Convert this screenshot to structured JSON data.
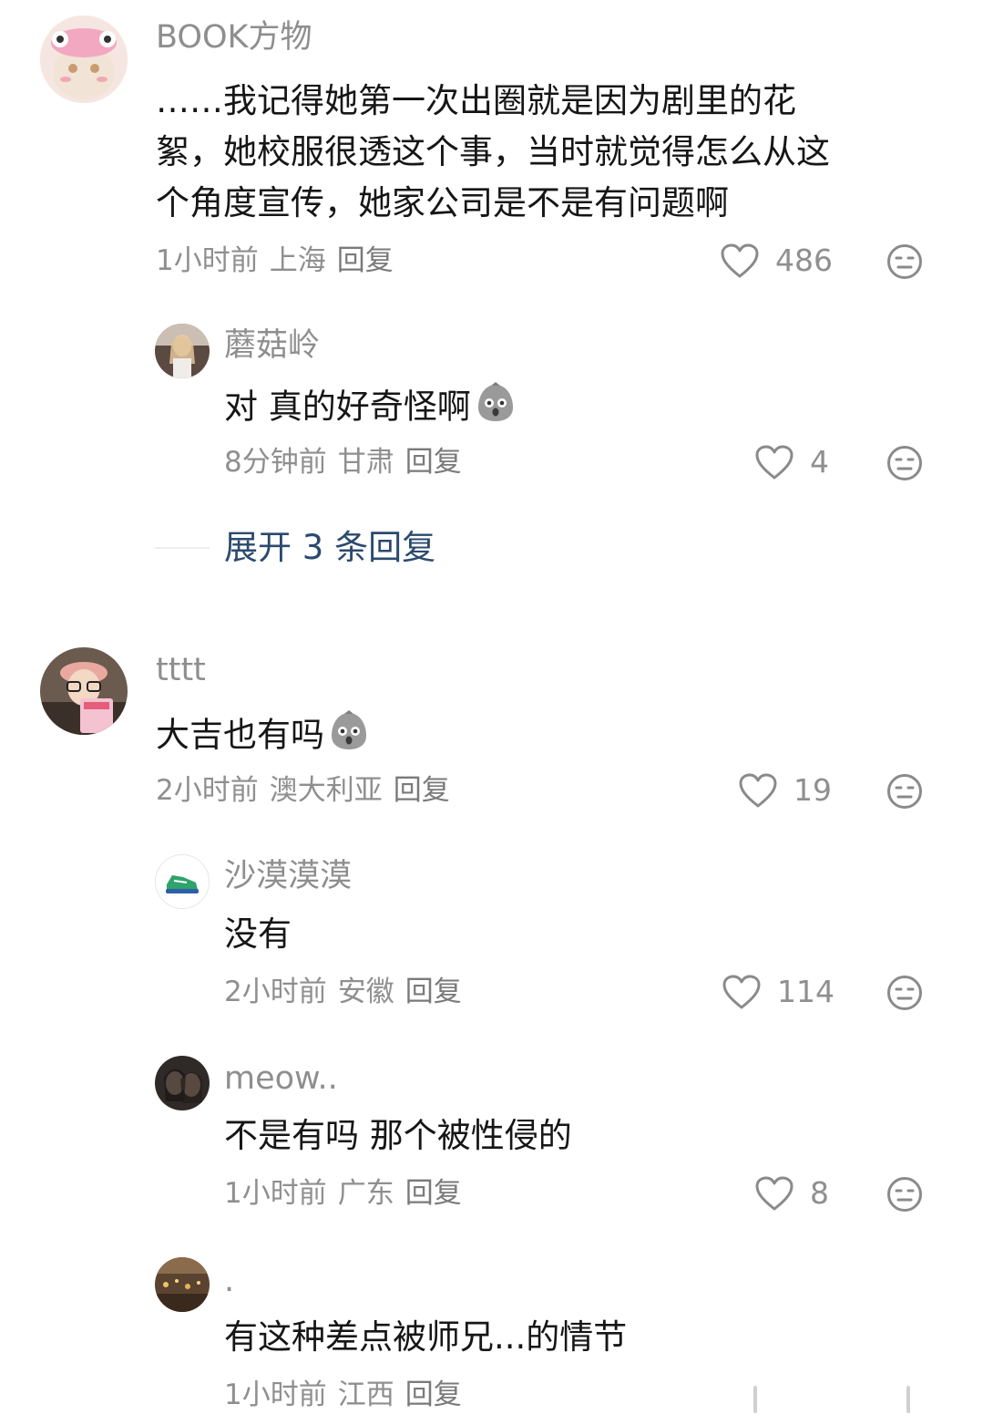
{
  "comments": [
    {
      "username": "BOOK方物",
      "text_lines": [
        "……我记得她第一次出圈就是因为剧里的花",
        "絮，她校服很透这个事，当时就觉得怎么从这",
        "个角度宣传，她家公司是不是有问题啊"
      ],
      "time": "1小时前",
      "location": "上海",
      "reply_label": "回复",
      "likes": "486"
    },
    {
      "username": "蘑菇岭",
      "text": "对 真的好奇怪啊",
      "time": "8分钟前",
      "location": "甘肃",
      "reply_label": "回复",
      "likes": "4"
    },
    {
      "username": "tttt",
      "text": "大吉也有吗",
      "time": "2小时前",
      "location": "澳大利亚",
      "reply_label": "回复",
      "likes": "19"
    },
    {
      "username": "沙漠漠漠",
      "text": "没有",
      "time": "2小时前",
      "location": "安徽",
      "reply_label": "回复",
      "likes": "114"
    },
    {
      "username": "meow..",
      "text": "不是有吗 那个被性侵的",
      "time": "1小时前",
      "location": "广东",
      "reply_label": "回复",
      "likes": "8"
    },
    {
      "username": ".",
      "text": "有这种差点被师兄...的情节",
      "time": "1小时前",
      "location": "江西",
      "reply_label": "回复"
    }
  ],
  "expand_replies": "展开 3 条回复",
  "icons": {
    "like": "heart-outline-icon",
    "dislike": "meh-face-icon",
    "inline_emoji": "grey-shocked-emoji"
  },
  "colors": {
    "username": "#8e8e8e",
    "meta": "#8f8f8f",
    "expand": "#2b4a6e"
  }
}
